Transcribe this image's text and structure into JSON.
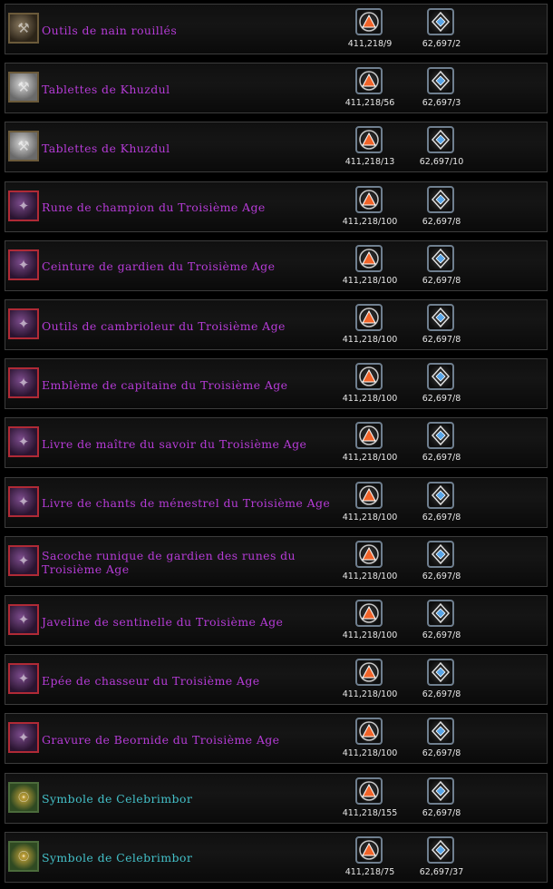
{
  "currencies": [
    {
      "name": "triangle-currency-icon",
      "color": "#f0642a"
    },
    {
      "name": "diamond-currency-icon",
      "color": "#5aa6e8"
    }
  ],
  "rows": [
    {
      "name": "Outils de nain rouillés",
      "icon": "dwarf-tools-icon",
      "rarity": "common",
      "cost1": "411,218/9",
      "cost2": "62,697/2"
    },
    {
      "name": "Tablettes de Khuzdul",
      "icon": "stone-tablet-icon",
      "rarity": "common",
      "cost1": "411,218/56",
      "cost2": "62,697/3"
    },
    {
      "name": "Tablettes de Khuzdul",
      "icon": "stone-tablet-icon",
      "rarity": "common",
      "cost1": "411,218/13",
      "cost2": "62,697/10"
    },
    {
      "name": "Rune de champion du Troisième Age",
      "icon": "champion-rune-icon",
      "rarity": "legendary",
      "cost1": "411,218/100",
      "cost2": "62,697/8"
    },
    {
      "name": "Ceinture de gardien du Troisième Age",
      "icon": "guardian-belt-icon",
      "rarity": "legendary",
      "cost1": "411,218/100",
      "cost2": "62,697/8"
    },
    {
      "name": "Outils de cambrioleur du Troisième Age",
      "icon": "burglar-tools-icon",
      "rarity": "legendary",
      "cost1": "411,218/100",
      "cost2": "62,697/8"
    },
    {
      "name": "Emblème de capitaine du Troisième Age",
      "icon": "captain-emblem-icon",
      "rarity": "legendary",
      "cost1": "411,218/100",
      "cost2": "62,697/8"
    },
    {
      "name": "Livre de maître du savoir du Troisième Age",
      "icon": "lore-master-book-icon",
      "rarity": "legendary",
      "cost1": "411,218/100",
      "cost2": "62,697/8"
    },
    {
      "name": "Livre de chants de ménestrel du Troisième Age",
      "icon": "minstrel-songbook-icon",
      "rarity": "legendary",
      "cost1": "411,218/100",
      "cost2": "62,697/8"
    },
    {
      "name": "Sacoche runique de gardien des runes du Troisième Age",
      "icon": "runekeeper-satchel-icon",
      "rarity": "legendary",
      "cost1": "411,218/100",
      "cost2": "62,697/8"
    },
    {
      "name": "Javeline de sentinelle du Troisième Age",
      "icon": "warden-javelin-icon",
      "rarity": "legendary",
      "cost1": "411,218/100",
      "cost2": "62,697/8"
    },
    {
      "name": "Epée de chasseur du Troisième Age",
      "icon": "hunter-sword-icon",
      "rarity": "legendary",
      "cost1": "411,218/100",
      "cost2": "62,697/8"
    },
    {
      "name": "Gravure de Beornide du Troisième Age",
      "icon": "beorning-carving-icon",
      "rarity": "legendary",
      "cost1": "411,218/100",
      "cost2": "62,697/8"
    },
    {
      "name": "Symbole de Celebrimbor",
      "icon": "celebrimbor-symbol-icon",
      "rarity": "green",
      "cost1": "411,218/155",
      "cost2": "62,697/8"
    },
    {
      "name": "Symbole de Celebrimbor",
      "icon": "celebrimbor-symbol-icon",
      "rarity": "green",
      "cost1": "411,218/75",
      "cost2": "62,697/37"
    }
  ]
}
